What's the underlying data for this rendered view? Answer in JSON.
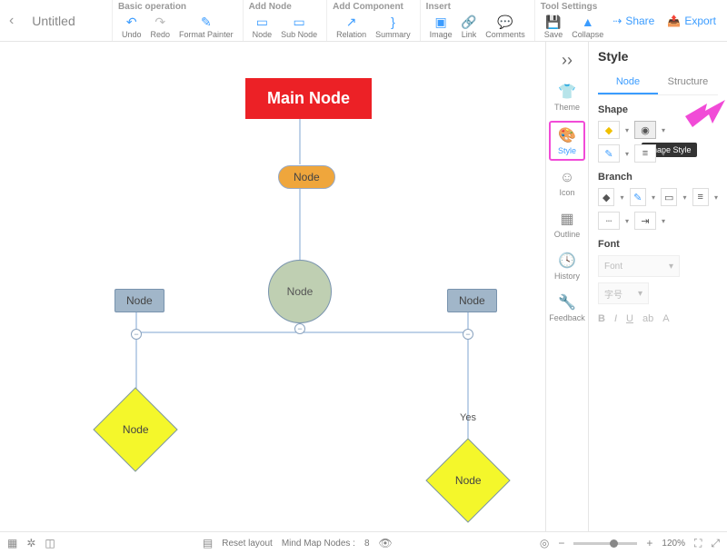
{
  "document": {
    "title": "Untitled"
  },
  "toolbar": {
    "groups": [
      {
        "title": "Basic operation",
        "items": [
          "Undo",
          "Redo",
          "Format Painter"
        ]
      },
      {
        "title": "Add Node",
        "items": [
          "Node",
          "Sub Node"
        ]
      },
      {
        "title": "Add Component",
        "items": [
          "Relation",
          "Summary"
        ]
      },
      {
        "title": "Insert",
        "items": [
          "Image",
          "Link",
          "Comments"
        ]
      },
      {
        "title": "Tool Settings",
        "items": [
          "Save",
          "Collapse"
        ]
      }
    ],
    "share": "Share",
    "export": "Export"
  },
  "rightstrip": {
    "items": [
      "Theme",
      "Style",
      "Icon",
      "Outline",
      "History",
      "Feedback"
    ],
    "active": "Style"
  },
  "panel": {
    "title": "Style",
    "tabs": {
      "node": "Node",
      "structure": "Structure",
      "active": "Node"
    },
    "sections": {
      "shape": "Shape",
      "branch": "Branch",
      "font": "Font"
    },
    "tooltip": "Shape Style",
    "fontPlaceholder": "Font",
    "sizePlaceholder": "字号"
  },
  "diagram": {
    "main": "Main Node",
    "node": "Node",
    "yes": "Yes"
  },
  "bottom": {
    "reset": "Reset layout",
    "countLabel": "Mind Map Nodes :",
    "count": "8",
    "zoom": "120%"
  }
}
